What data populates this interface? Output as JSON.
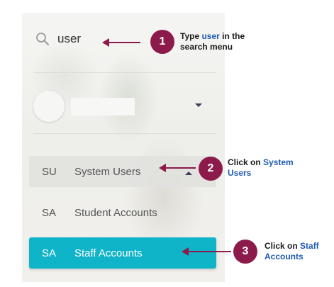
{
  "search": {
    "value": "user",
    "icon": "search-icon"
  },
  "profile": {
    "avatar_icon": "avatar",
    "dropdown_icon": "chevron-down-icon"
  },
  "menu": {
    "items": [
      {
        "abbr": "SU",
        "label": "System Users",
        "state": "expanded"
      },
      {
        "abbr": "SA",
        "label": "Student Accounts",
        "state": "normal"
      },
      {
        "abbr": "SA",
        "label": "Staff Accounts",
        "state": "active"
      }
    ]
  },
  "callouts": [
    {
      "number": "1",
      "prefix": "Type ",
      "highlight": "user",
      "suffix": " in the search menu"
    },
    {
      "number": "2",
      "prefix": "Click on ",
      "highlight": "System Users",
      "suffix": ""
    },
    {
      "number": "3",
      "prefix": "Click on ",
      "highlight": "Staff Accounts",
      "suffix": ""
    }
  ],
  "colors": {
    "badge": "#8c1a4a",
    "highlight_text": "#1e5bb5",
    "active_item": "#10b4c9",
    "arrow": "#8c1a4a"
  }
}
